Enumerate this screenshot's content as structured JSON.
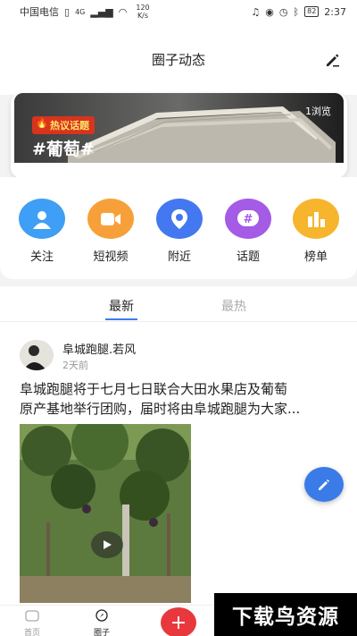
{
  "status_bar": {
    "carrier": "中国电信",
    "signal": "4G",
    "speed_value": "120",
    "speed_unit": "K/s",
    "battery": "82",
    "time": "2:37"
  },
  "header": {
    "title": "圈子动态",
    "edit_icon": "pencil-icon"
  },
  "banner": {
    "tag": "热议话题",
    "topic": "#葡萄#",
    "views": "1浏览"
  },
  "categories": [
    {
      "label": "关注",
      "icon": "person-icon",
      "color": "#3f9ef5"
    },
    {
      "label": "短视频",
      "icon": "video-icon",
      "color": "#f7a03a"
    },
    {
      "label": "附近",
      "icon": "location-icon",
      "color": "#4478f0"
    },
    {
      "label": "话题",
      "icon": "hashtag-icon",
      "color": "#a45be6"
    },
    {
      "label": "榜单",
      "icon": "chart-icon",
      "color": "#f6b52c"
    }
  ],
  "tabs": [
    {
      "label": "最新",
      "active": true
    },
    {
      "label": "最热",
      "active": false
    }
  ],
  "post": {
    "author": "阜城跑腿.若风",
    "time": "2天前",
    "text_line1": "阜城跑腿将于七月七日联合大田水果店及葡萄",
    "text_line2": "原产基地举行团购，届时将由阜城跑腿为大家..."
  },
  "bottom_nav": {
    "home": "首页",
    "circle": "圈子",
    "plus": "+"
  },
  "watermark": "下载鸟资源",
  "colors": {
    "accent": "#3c7cf0",
    "plus_button": "#e8383d",
    "hot_tag": "#d8341d"
  }
}
